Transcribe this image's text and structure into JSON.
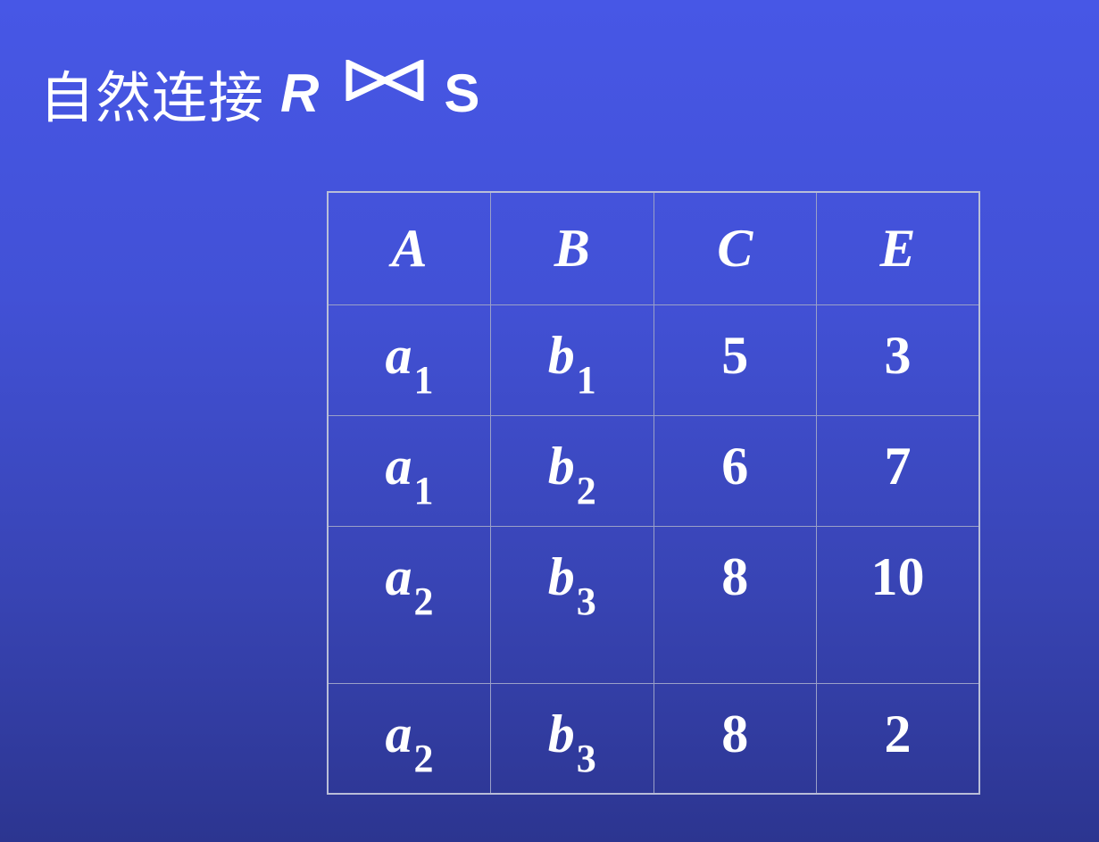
{
  "title": {
    "text": "自然连接",
    "left_relation": "R",
    "operator_icon": "bowtie-join-icon",
    "right_relation": "S"
  },
  "table": {
    "headers": [
      "A",
      "B",
      "C",
      "E"
    ],
    "rows": [
      {
        "a": {
          "sym": "a",
          "sub": "1"
        },
        "b": {
          "sym": "b",
          "sub": "1"
        },
        "c": "5",
        "e": "3"
      },
      {
        "a": {
          "sym": "a",
          "sub": "1"
        },
        "b": {
          "sym": "b",
          "sub": "2"
        },
        "c": "6",
        "e": "7"
      },
      {
        "a": {
          "sym": "a",
          "sub": "2"
        },
        "b": {
          "sym": "b",
          "sub": "3"
        },
        "c": "8",
        "e": "10"
      },
      {
        "a": {
          "sym": "a",
          "sub": "2"
        },
        "b": {
          "sym": "b",
          "sub": "3"
        },
        "c": "8",
        "e": "2"
      }
    ]
  },
  "colors": {
    "background_top": "#4757e6",
    "background_bottom": "#2c3590",
    "text": "#ffffff",
    "grid": "#9aa0c8"
  }
}
